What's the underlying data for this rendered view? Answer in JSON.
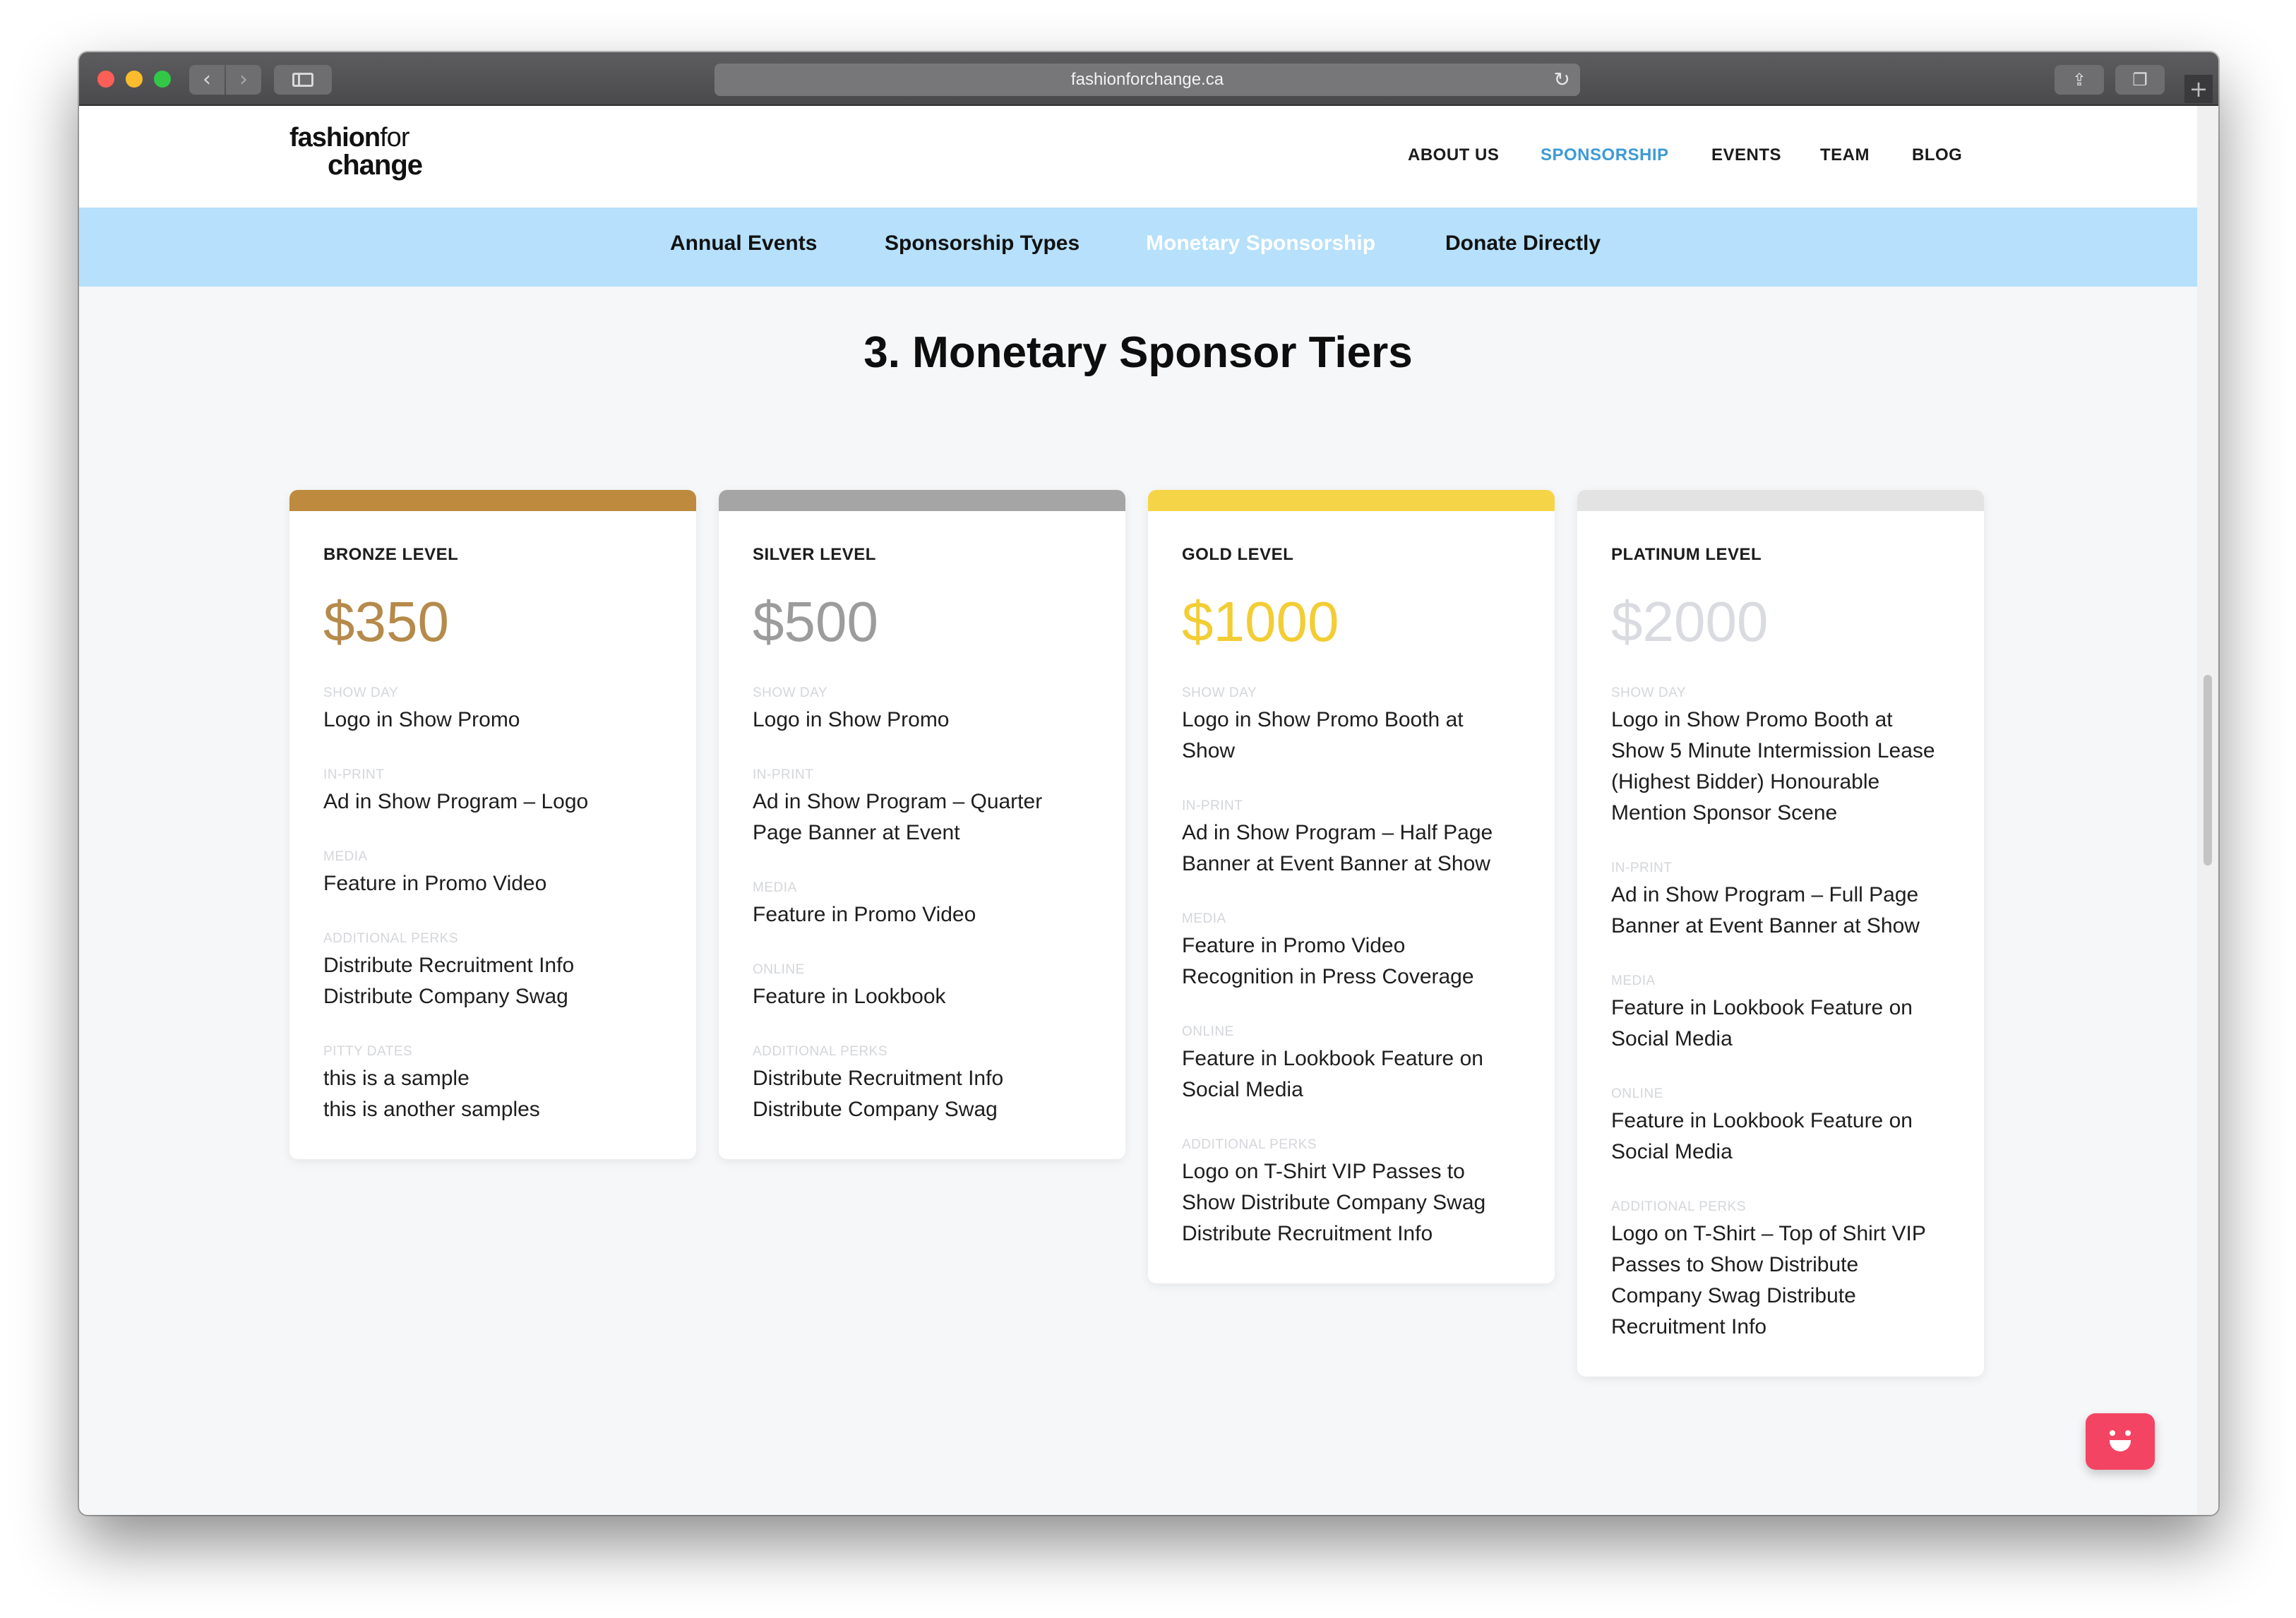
{
  "browser": {
    "url": "fashionforchange.ca",
    "back_glyph": "‹",
    "forward_glyph": "›",
    "reload_glyph": "↻",
    "share_glyph": "⇪",
    "tabs_glyph": "❐",
    "newtab_glyph": "+"
  },
  "site": {
    "logo_line1_bold": "fashion",
    "logo_line1_light": "for",
    "logo_line2": "change"
  },
  "main_nav": [
    {
      "label": "ABOUT US",
      "active": false
    },
    {
      "label": "SPONSORSHIP",
      "active": true
    },
    {
      "label": "EVENTS",
      "active": false
    },
    {
      "label": "TEAM",
      "active": false
    },
    {
      "label": "BLOG",
      "active": false
    }
  ],
  "sub_nav": [
    {
      "label": "Annual Events",
      "active": false
    },
    {
      "label": "Sponsorship Types",
      "active": false
    },
    {
      "label": "Monetary Sponsorship",
      "active": true
    },
    {
      "label": "Donate Directly",
      "active": false
    }
  ],
  "section_title": "3. Monetary Sponsor Tiers",
  "colors": {
    "bronze": "#bd8a3e",
    "silver": "#a5a5a5",
    "gold": "#f5d547",
    "platinum": "#e3e3e3",
    "bronze_price": "#b58a4a",
    "silver_price": "#9c9c9c",
    "gold_price": "#f2cd34",
    "platinum_price": "#d9dbe0",
    "accent_blue": "#3d9ad6",
    "subnav_bg": "#b6e0fb"
  },
  "tiers": [
    {
      "level": "BRONZE LEVEL",
      "price": "$350",
      "groups": [
        {
          "label": "SHOW DAY",
          "text": "Logo in Show Promo"
        },
        {
          "label": "IN-PRINT",
          "text": "Ad in Show Program – Logo"
        },
        {
          "label": "MEDIA",
          "text": "Feature in Promo Video"
        },
        {
          "label": "ADDITIONAL PERKS",
          "text": "Distribute Recruitment Info\nDistribute Company Swag"
        },
        {
          "label": "PITTY DATES",
          "text": "this is a sample\nthis is another samples"
        }
      ]
    },
    {
      "level": "SILVER LEVEL",
      "price": "$500",
      "groups": [
        {
          "label": "SHOW DAY",
          "text": "Logo in Show Promo"
        },
        {
          "label": "IN-PRINT",
          "text": "Ad in Show Program – Quarter\nPage Banner at Event"
        },
        {
          "label": "MEDIA",
          "text": "Feature in Promo Video"
        },
        {
          "label": "ONLINE",
          "text": "Feature in Lookbook"
        },
        {
          "label": "ADDITIONAL PERKS",
          "text": "Distribute Recruitment Info\nDistribute Company Swag"
        }
      ]
    },
    {
      "level": "GOLD LEVEL",
      "price": "$1000",
      "groups": [
        {
          "label": "SHOW DAY",
          "text": "Logo in Show Promo Booth at\nShow"
        },
        {
          "label": "IN-PRINT",
          "text": "Ad in Show Program – Half Page\nBanner at Event Banner at Show"
        },
        {
          "label": "MEDIA",
          "text": "Feature in Promo Video\nRecognition in Press Coverage"
        },
        {
          "label": "ONLINE",
          "text": "Feature in Lookbook Feature on\nSocial Media"
        },
        {
          "label": "ADDITIONAL PERKS",
          "text": "Logo on T-Shirt VIP Passes to\nShow Distribute Company Swag\nDistribute Recruitment Info"
        }
      ]
    },
    {
      "level": "PLATINUM LEVEL",
      "price": "$2000",
      "groups": [
        {
          "label": "SHOW DAY",
          "text": "Logo in Show Promo Booth at\nShow 5 Minute Intermission Lease\n(Highest Bidder) Honourable\nMention Sponsor Scene"
        },
        {
          "label": "IN-PRINT",
          "text": "Ad in Show Program – Full Page\nBanner at Event Banner at Show"
        },
        {
          "label": "MEDIA",
          "text": "Feature in Lookbook Feature on\nSocial Media"
        },
        {
          "label": "ONLINE",
          "text": "Feature in Lookbook Feature on\nSocial Media"
        },
        {
          "label": "ADDITIONAL PERKS",
          "text": "Logo on T-Shirt – Top of Shirt VIP\nPasses to Show Distribute\nCompany Swag Distribute\nRecruitment Info"
        }
      ]
    }
  ]
}
